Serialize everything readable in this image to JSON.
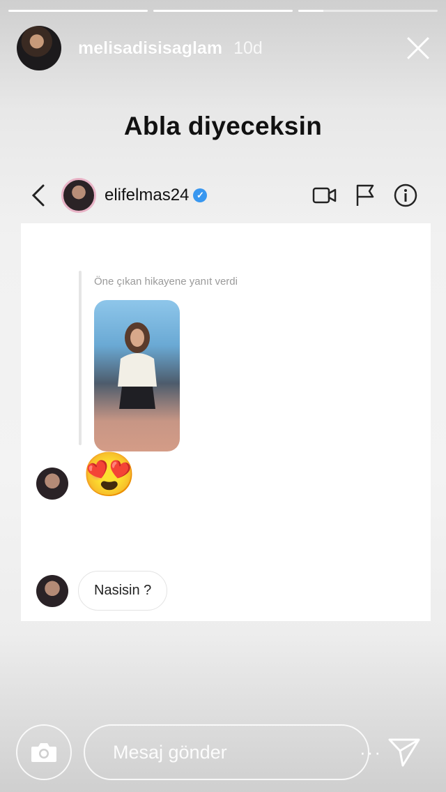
{
  "story": {
    "progress": [
      1.0,
      1.0,
      0.18
    ],
    "username": "melisadisisaglam",
    "time": "10d",
    "caption": "Abla diyeceksin"
  },
  "dm": {
    "username": "elifelmas24",
    "verified_mark": "✓",
    "icons": [
      "back-icon",
      "video-call-icon",
      "flag-icon",
      "info-icon"
    ],
    "reply_note": "Öne çıkan hikayene yanıt verdi",
    "emoji": "😍",
    "message": "Nasisin ?"
  },
  "footer": {
    "placeholder": "Mesaj gönder",
    "more": "···",
    "icons": [
      "camera-icon",
      "send-icon"
    ]
  },
  "colors": {
    "verified": "#3897f0",
    "avatar_ring": "#e8b3c6"
  }
}
